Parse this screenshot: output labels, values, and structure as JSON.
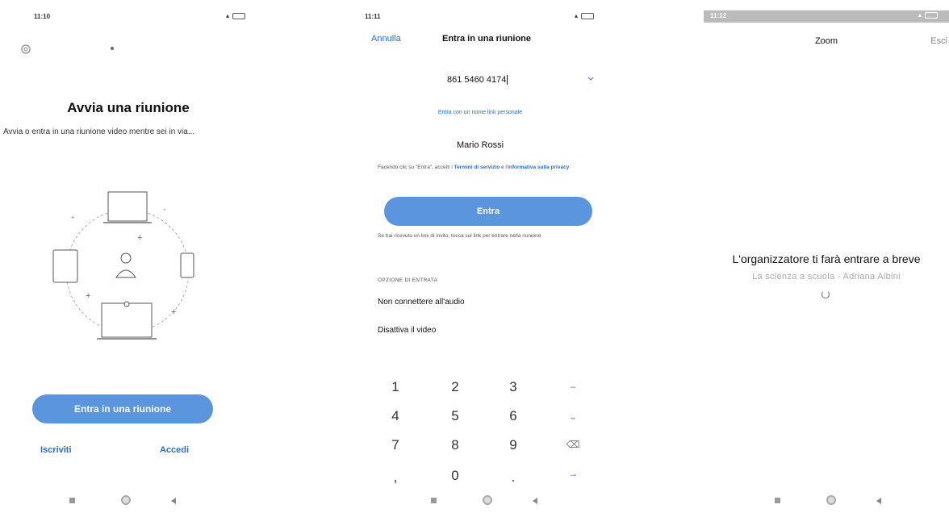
{
  "screen1": {
    "time": "11:10",
    "title": "Avvia una riunione",
    "subtitle": "Avvia o entra in una riunione video mentre sei in via...",
    "join_button": "Entra in una riunione",
    "signup_link": "Iscriviti",
    "login_link": "Accedi"
  },
  "screen2": {
    "time": "11:11",
    "cancel": "Annulla",
    "title": "Entra in una riunione",
    "meeting_id": "861 5460 4174",
    "personal_link": "Entra con un nome link personale",
    "name": "Mario Rossi",
    "terms_prefix": "Facendo clic su \"Entra\", accetti i ",
    "terms_link": "Termini di servizio",
    "terms_mid": " e l'",
    "privacy_link": "informativa sulla privacy",
    "join_button": "Entra",
    "invite_hint": "Se hai ricevuto un link di invito, tocca sul link per entrare nella riunione",
    "options_header": "OPZIONE DI ENTRATA",
    "option_audio": "Non connettere all'audio",
    "option_video": "Disattiva il video",
    "keypad": [
      "1",
      "2",
      "3",
      "4",
      "5",
      "6",
      "7",
      "8",
      "9",
      ",",
      "0",
      "."
    ]
  },
  "screen3": {
    "time": "11:12",
    "title": "Zoom",
    "exit": "Esci",
    "waiting_message": "L'organizzatore ti farà entrare a breve",
    "meeting_name": "La scienza a scuola - Adriana Albini"
  },
  "colors": {
    "accent": "#5b95dd",
    "link": "#2d6fc7"
  }
}
